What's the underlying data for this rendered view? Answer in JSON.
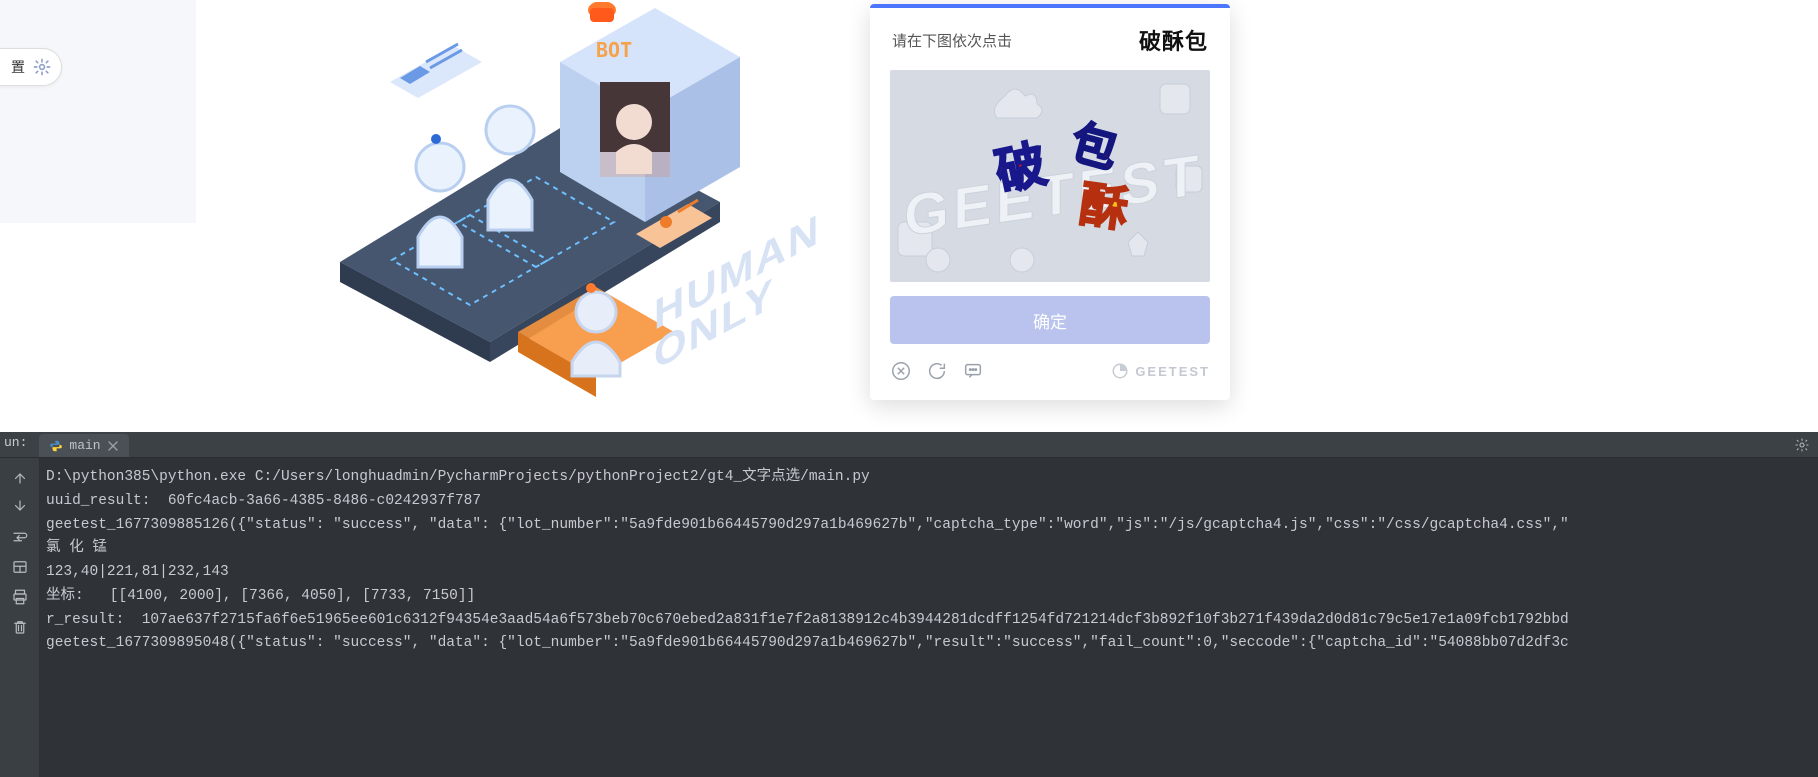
{
  "page": {
    "settings_pill_label": "置",
    "human_only_line1": "HUMAN",
    "human_only_line2": "ONLY",
    "illustration": {
      "bot_label": "BOT"
    }
  },
  "captcha": {
    "instruction": "请在下图依次点击",
    "target_chars": "破酥包",
    "confirm_label": "确定",
    "brand": "GEETEST",
    "challenge_chars": [
      "破",
      "包",
      "酥"
    ],
    "bg_word": "GEETEST"
  },
  "ide": {
    "tool_label": "un:",
    "tab_name": "main",
    "gutter_tools": [
      "step-up",
      "step-down",
      "wrap",
      "layout",
      "print",
      "trash"
    ],
    "console_lines": [
      "D:\\python385\\python.exe C:/Users/longhuadmin/PycharmProjects/pythonProject2/gt4_文字点选/main.py",
      "uuid_result:  60fc4acb-3a66-4385-8486-c0242937f787",
      "geetest_1677309885126({\"status\": \"success\", \"data\": {\"lot_number\":\"5a9fde901b66445790d297a1b469627b\",\"captcha_type\":\"word\",\"js\":\"/js/gcaptcha4.js\",\"css\":\"/css/gcaptcha4.css\",\"",
      "氯 化 锰",
      "123,40|221,81|232,143",
      "坐标:   [[4100, 2000], [7366, 4050], [7733, 7150]]",
      "r_result:  107ae637f2715fa6f6e51965ee601c6312f94354e3aad54a6f573beb70c670ebed2a831f1e7f2a8138912c4b3944281dcdff1254fd721214dcf3b892f10f3b271f439da2d0d81c79c5e17e1a09fcb1792bbd",
      "geetest_1677309895048({\"status\": \"success\", \"data\": {\"lot_number\":\"5a9fde901b66445790d297a1b469627b\",\"result\":\"success\",\"fail_count\":0,\"seccode\":{\"captcha_id\":\"54088bb07d2df3c"
    ]
  }
}
